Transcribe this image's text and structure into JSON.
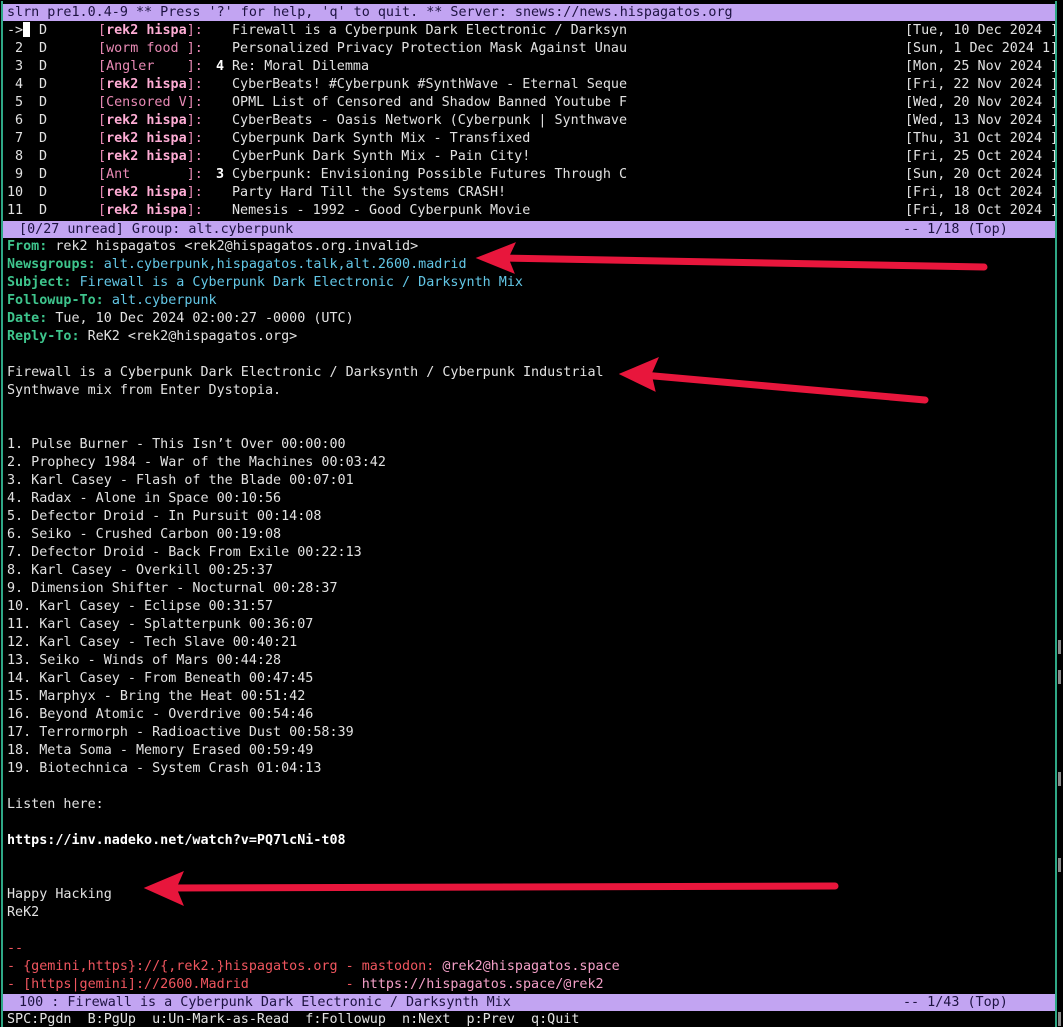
{
  "top_bar": "slrn pre1.0.4-9 ** Press '?' for help, 'q' to quit. ** Server: snews://news.hispagatos.org",
  "cursor_marker": "->",
  "articles": [
    {
      "num": "",
      "flag": "D",
      "author_bold": "rek2 hispa",
      "author_rest": "",
      "thread": "",
      "subject": "Firewall is a Cyberpunk Dark Electronic / Darksyn",
      "date": "[Tue, 10 Dec 2024 ]"
    },
    {
      "num": "2",
      "flag": "D",
      "author_bold": "",
      "author_rest": "worm food ",
      "thread": "",
      "subject": "Personalized Privacy Protection Mask Against Unau",
      "date": "[Sun, 1 Dec 2024 1]"
    },
    {
      "num": "3",
      "flag": "D",
      "author_bold": "",
      "author_rest": "Angler    ",
      "thread": "4",
      "subject": "Re: Moral Dilemma",
      "date": "[Mon, 25 Nov 2024 ]"
    },
    {
      "num": "4",
      "flag": "D",
      "author_bold": "rek2 hispa",
      "author_rest": "",
      "thread": "",
      "subject": "CyberBeats! #Cyberpunk #SynthWave - Eternal Seque",
      "date": "[Fri, 22 Nov 2024 ]"
    },
    {
      "num": "5",
      "flag": "D",
      "author_bold": "",
      "author_rest": "Censored V",
      "thread": "",
      "subject": "OPML List of Censored and Shadow Banned Youtube F",
      "date": "[Wed, 20 Nov 2024 ]"
    },
    {
      "num": "6",
      "flag": "D",
      "author_bold": "rek2 hispa",
      "author_rest": "",
      "thread": "",
      "subject": "CyberBeats - Oasis Network (Cyberpunk | Synthwave",
      "date": "[Wed, 13 Nov 2024 ]"
    },
    {
      "num": "7",
      "flag": "D",
      "author_bold": "rek2 hispa",
      "author_rest": "",
      "thread": "",
      "subject": "Cyberpunk Dark Synth Mix - Transfixed",
      "date": "[Thu, 31 Oct 2024 ]"
    },
    {
      "num": "8",
      "flag": "D",
      "author_bold": "rek2 hispa",
      "author_rest": "",
      "thread": "",
      "subject": "CyberPunk Dark Synth Mix - Pain City!",
      "date": "[Fri, 25 Oct 2024 ]"
    },
    {
      "num": "9",
      "flag": "D",
      "author_bold": "",
      "author_rest": "Ant       ",
      "thread": "3",
      "subject": "Cyberpunk: Envisioning Possible Futures Through C",
      "date": "[Sun, 20 Oct 2024 ]"
    },
    {
      "num": "10",
      "flag": "D",
      "author_bold": "rek2 hispa",
      "author_rest": "",
      "thread": "",
      "subject": "Party Hard Till the Systems CRASH!",
      "date": "[Fri, 18 Oct 2024 ]"
    },
    {
      "num": "11",
      "flag": "D",
      "author_bold": "rek2 hispa",
      "author_rest": "",
      "thread": "",
      "subject": "Nemesis - 1992 - Good Cyberpunk Movie",
      "date": "[Fri, 18 Oct 2024 ]"
    }
  ],
  "group_bar": {
    "left": " [0/27 unread] Group: alt.cyberpunk",
    "right": "-- 1/18 (Top)"
  },
  "headers": [
    {
      "name": "From:",
      "value": "rek2 hispagatos <rek2@hispagatos.org.invalid>"
    },
    {
      "name": "Newsgroups:",
      "value": "alt.cyberpunk,hispagatos.talk,alt.2600.madrid"
    },
    {
      "name": "Subject:",
      "value": "Firewall is a Cyberpunk Dark Electronic / Darksynth Mix"
    },
    {
      "name": "Followup-To:",
      "value": "alt.cyberpunk"
    },
    {
      "name": "Date:",
      "value": "Tue, 10 Dec 2024 02:00:27 -0000 (UTC)"
    },
    {
      "name": "Reply-To:",
      "value": "ReK2 <rek2@hispagatos.org>"
    }
  ],
  "body_intro": [
    "Firewall is a Cyberpunk Dark Electronic / Darksynth / Cyberpunk Industrial",
    "Synthwave mix from Enter Dystopia."
  ],
  "tracklist": [
    "1. Pulse Burner - This Isn’t Over 00:00:00",
    "2. Prophecy 1984 - War of the Machines 00:03:42",
    "3. Karl Casey - Flash of the Blade 00:07:01",
    "4. Radax - Alone in Space 00:10:56",
    "5. Defector Droid - In Pursuit 00:14:08",
    "6. Seiko - Crushed Carbon 00:19:08",
    "7. Defector Droid - Back From Exile 00:22:13",
    "8. Karl Casey - Overkill 00:25:37",
    "9. Dimension Shifter - Nocturnal 00:28:37",
    "10. Karl Casey - Eclipse 00:31:57",
    "11. Karl Casey - Splatterpunk 00:36:07",
    "12. Karl Casey - Tech Slave 00:40:21",
    "13. Seiko - Winds of Mars 00:44:28",
    "14. Karl Casey - From Beneath 00:47:45",
    "15. Marphyx - Bring the Heat 00:51:42",
    "16. Beyond Atomic - Overdrive 00:54:46",
    "17. Terrormorph - Radioactive Dust 00:58:39",
    "18. Meta Soma - Memory Erased 00:59:49",
    "19. Biotechnica - System Crash 01:04:13"
  ],
  "listen_label": "Listen here:",
  "listen_url": "https://inv.nadeko.net/watch?v=PQ7lcNi-t08",
  "closing": [
    "Happy Hacking",
    "ReK2"
  ],
  "sig_sep": "--",
  "sig1_left": "- {gemini,https}://{,rek2.}hispagatos.org - mastodon: ",
  "sig1_right": "@rek2@hispagatos.space",
  "sig2_left": "- [https|gemini]://2600.Madrid            - ",
  "sig2_right": "https://hispagatos.space/@rek2",
  "article_bar": {
    "left": " 100 : Firewall is a Cyberpunk Dark Electronic / Darksynth Mix",
    "right": "-- 1/43 (Top)"
  },
  "help_line": "SPC:Pgdn  B:PgUp  u:Un-Mark-as-Read  f:Followup  n:Next  p:Prev  q:Quit",
  "colors": {
    "bar": "#c2a4f2",
    "header": "#3ec58d",
    "author": "#e98ab5",
    "signature": "#f0565f",
    "arrow": "#e8163c",
    "border": "#2fa887"
  }
}
